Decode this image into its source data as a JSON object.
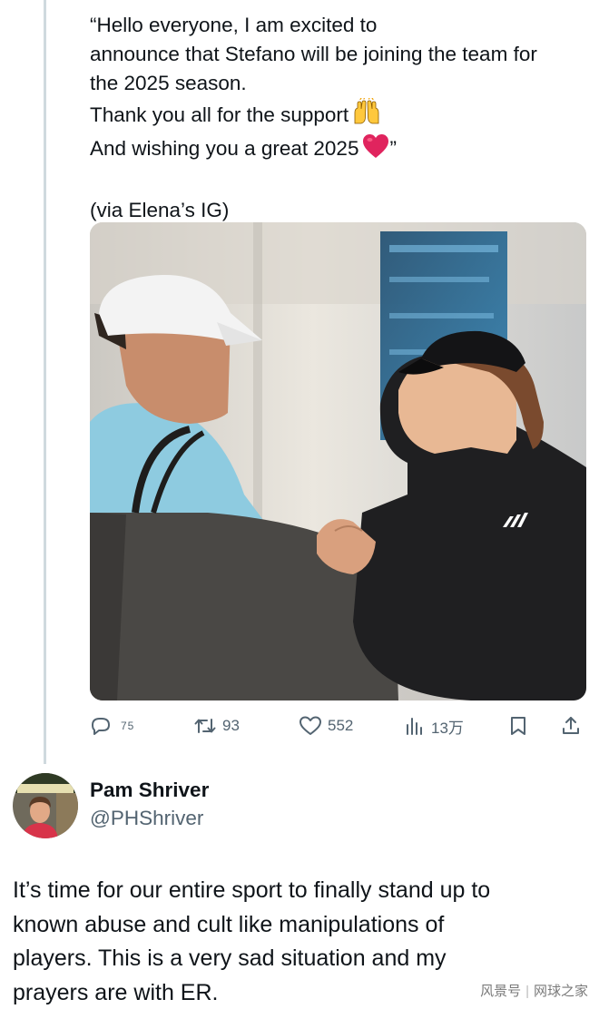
{
  "quoted_post": {
    "lines": [
      "“Hello everyone, I am excited to",
      "announce that Stefano will be joining the team for",
      "the 2025 season.",
      "Thank you all for the support",
      "And wishing you a great 2025",
      "(via Elena’s IG)"
    ],
    "closing_quote": "”",
    "emoji": [
      "raising-hands-emoji",
      "red-heart-emoji"
    ]
  },
  "actions": {
    "reply_count": "75",
    "retweet_count": "93",
    "like_count": "552",
    "view_count": "13万"
  },
  "author": {
    "name": "Pam Shriver",
    "handle": "@PHShriver"
  },
  "reply": {
    "lines": [
      "It’s time for our entire sport to finally stand up to",
      "known abuse and cult like manipulations of",
      "players. This is a very sad situation and my",
      "prayers are with ER."
    ]
  },
  "watermark": {
    "left": "风景号",
    "right": "网球之家"
  },
  "colors": {
    "text": "#0f1419",
    "muted": "#536471",
    "thread_line": "#cfd9de",
    "heart": "#e0245e"
  }
}
